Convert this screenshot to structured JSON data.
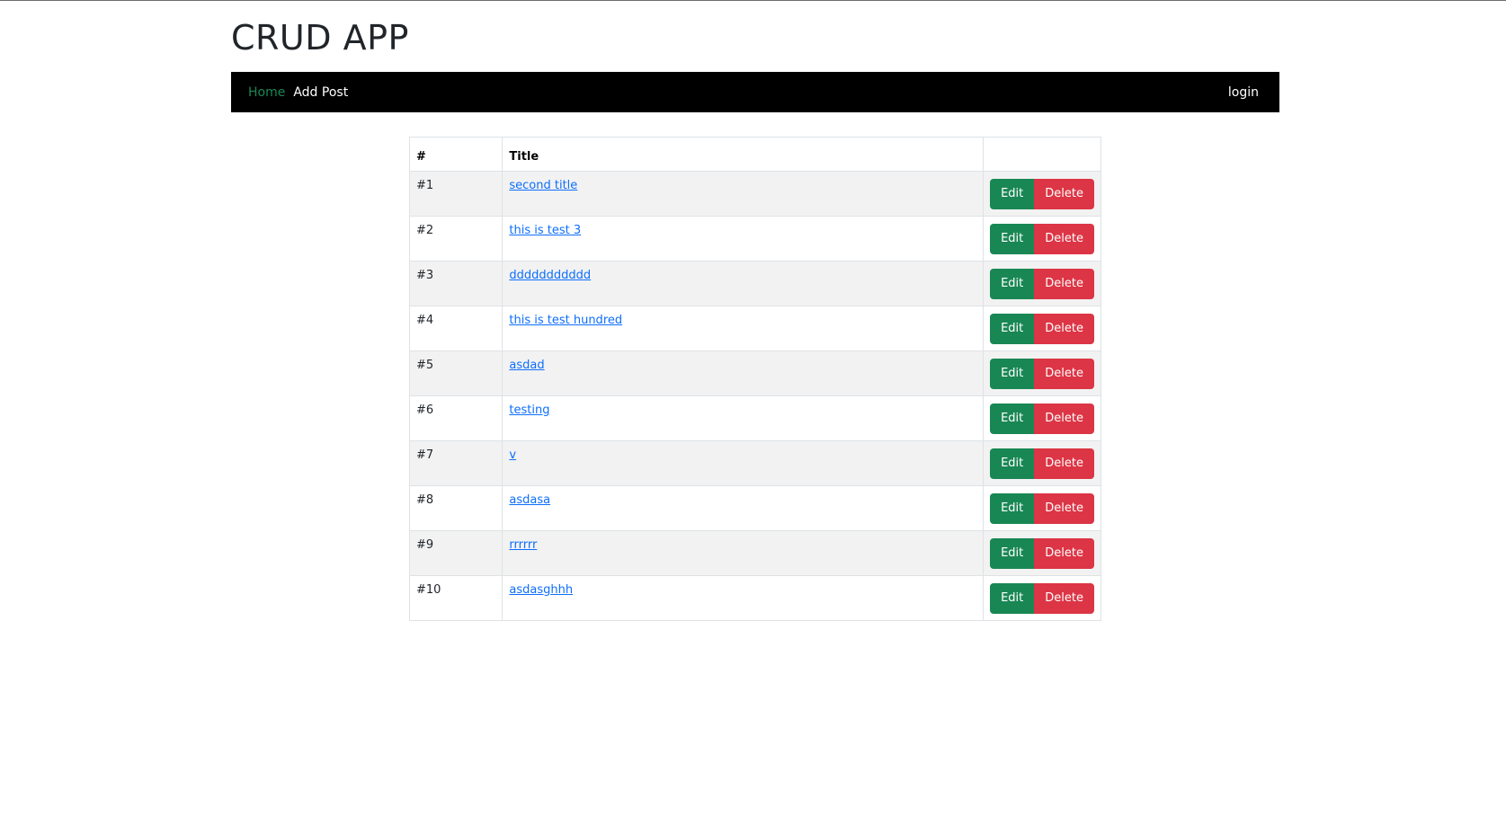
{
  "app": {
    "title": "CRUD APP"
  },
  "nav": {
    "home": "Home",
    "add_post": "Add Post",
    "login": "login"
  },
  "table": {
    "headers": {
      "id": "#",
      "title": "Title",
      "actions": ""
    },
    "edit_label": "Edit",
    "delete_label": "Delete",
    "rows": [
      {
        "id": "#1",
        "title": "second title"
      },
      {
        "id": "#2",
        "title": "this is test 3"
      },
      {
        "id": "#3",
        "title": "ddddddddddd"
      },
      {
        "id": "#4",
        "title": "this is test hundred"
      },
      {
        "id": "#5",
        "title": "asdad"
      },
      {
        "id": "#6",
        "title": "testing"
      },
      {
        "id": "#7",
        "title": "v"
      },
      {
        "id": "#8",
        "title": "asdasa"
      },
      {
        "id": "#9",
        "title": "rrrrrr"
      },
      {
        "id": "#10",
        "title": "asdasghhh"
      }
    ]
  },
  "colors": {
    "navbar_bg": "#000000",
    "nav_active": "#198754",
    "edit_button": "#198754",
    "delete_button": "#dc3545",
    "link": "#0d6efd",
    "stripe": "#f2f2f2"
  }
}
